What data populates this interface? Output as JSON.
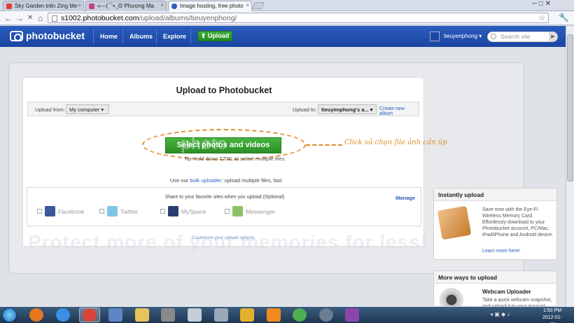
{
  "browser": {
    "tabs": [
      {
        "title": "Sky Garden trên Zing Me",
        "favicon_color": "#e0403a"
      },
      {
        "title": "«---(¯`•.¸Θ Phượng Ma",
        "favicon_color": "#c2408a"
      },
      {
        "title": "Image hosting, free photo",
        "favicon_color": "#2a5dbf"
      }
    ],
    "url_host": "s1002.photobucket.com",
    "url_path": "/upload/albums/tieuyenphong/",
    "back_glyph": "←",
    "forward_glyph": "→",
    "stop_glyph": "✕",
    "home_glyph": "⌂",
    "star_glyph": "☆",
    "wrench_glyph": "🔧",
    "close_glyph": "×",
    "window_controls": "─ □ ✕"
  },
  "header": {
    "logo": "photobucket",
    "nav": [
      "Home",
      "Albums",
      "Explore"
    ],
    "upload_button": "⬆ Upload",
    "user": "tieuyenphong ▾",
    "search_placeholder": "Search site",
    "search_go": "▶"
  },
  "upload": {
    "title": "Upload to Photobucket",
    "upload_from_label": "Upload from:",
    "upload_from_value": "My computer ▾",
    "upload_to_label": "Upload to:",
    "upload_to_value": "tieuyenphong's a... ▾",
    "create_album": "Create new album",
    "select_button": "Select photos and videos",
    "callout": "Click vả chọn file ảnh cần úp",
    "hint": "Tip: hold down CTRL to select multiple files.",
    "bulk_prefix": "Use our",
    "bulk_link": "bulk uploader",
    "bulk_suffix": ": upload multiple files, fast",
    "share_text": "Share to your favorite sites when you upload (Optional)",
    "manage": "Manage",
    "share_sites": [
      {
        "name": "Facebook",
        "color": "#3b5998"
      },
      {
        "name": "Twitter",
        "color": "#7fc6e8"
      },
      {
        "name": "MySpace",
        "color": "#2a3e70"
      },
      {
        "name": "Messenger",
        "color": "#8cc266"
      }
    ],
    "customize": "Customize your upload options",
    "watermark": "Protect more of your memories for less!",
    "watermark_logo": "photo"
  },
  "instant": {
    "title": "Instantly upload",
    "text": "Save time with the Eye-Fi Wireless Memory Card. Effortlessly download to your Photobucket account, PC/Mac, iPad/iPhone and Android device.",
    "learn": "Learn more here!"
  },
  "more_ways": {
    "title": "More ways to upload",
    "webcam_title": "Webcam Uploader",
    "webcam_text": "Take a quick webcam snapshot, and upload it to your account"
  },
  "taskbar": {
    "time": "1:50 PM",
    "date": "2012-01-13",
    "icons": [
      {
        "name": "firefox",
        "color": "#e5761f"
      },
      {
        "name": "ie",
        "color": "#3a8ee6"
      },
      {
        "name": "chrome",
        "color": "#d9453a"
      },
      {
        "name": "app",
        "color": "#5d87c4"
      },
      {
        "name": "explorer",
        "color": "#e8c35a"
      },
      {
        "name": "tool",
        "color": "#8a8a8a"
      },
      {
        "name": "calc",
        "color": "#c4ced8"
      },
      {
        "name": "phone",
        "color": "#9aa8b8"
      },
      {
        "name": "media",
        "color": "#e4b12c"
      },
      {
        "name": "vlc",
        "color": "#f08a1e"
      },
      {
        "name": "network",
        "color": "#4caf50"
      },
      {
        "name": "gear",
        "color": "#6a7d92"
      },
      {
        "name": "yahoo",
        "color": "#8e44ad"
      }
    ]
  }
}
